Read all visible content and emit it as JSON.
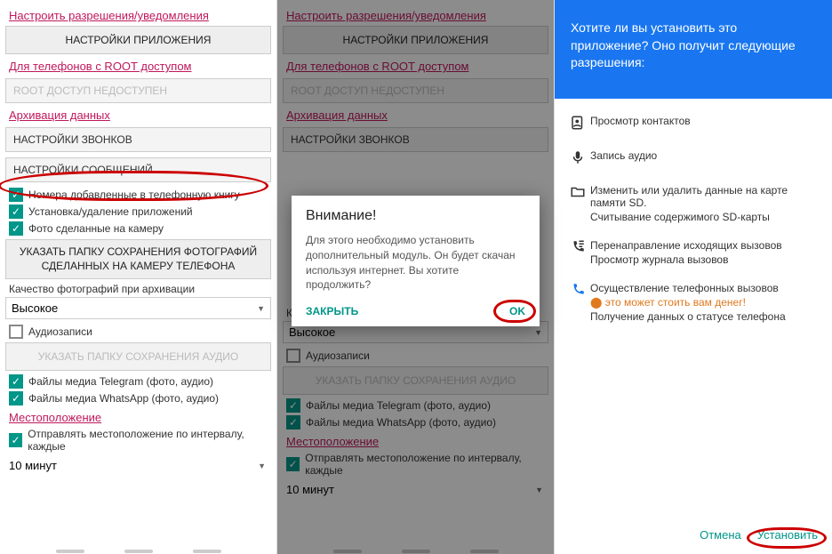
{
  "settings": {
    "permissions_title": "Настроить разрешения/уведомления",
    "app_settings_btn": "НАСТРОЙКИ ПРИЛОЖЕНИЯ",
    "root_title": "Для телефонов с ROOT доступом",
    "root_box": "ROOT ДОСТУП НЕДОСТУПЕН",
    "archive_title": "Архивация данных",
    "calls_box": "НАСТРОЙКИ ЗВОНКОВ",
    "messages_box": "НАСТРОЙКИ СООБЩЕНИЙ",
    "check_contacts": "Номера добавленные в телефонную книгу",
    "check_apps": "Установка/удаление приложений",
    "check_photos": "Фото сделанные на камеру",
    "photo_folder_btn": "УКАЗАТЬ ПАПКУ СОХРАНЕНИЯ ФОТОГРАФИЙ СДЕЛАННЫХ НА КАМЕРУ ТЕЛЕФОНА",
    "quality_label": "Качество фотографий при архивации",
    "quality_value": "Высокое",
    "check_audio": "Аудиозаписи",
    "audio_folder_btn": "УКАЗАТЬ ПАПКУ СОХРАНЕНИЯ АУДИО",
    "check_telegram": "Файлы медиа Telegram (фото, аудио)",
    "check_whatsapp": "Файлы медиа WhatsApp (фото, аудио)",
    "location_title": "Местоположение",
    "check_location": "Отправлять местоположение по интервалу, каждые",
    "interval_value": "10 минут"
  },
  "dialog": {
    "title": "Внимание!",
    "body": "Для этого необходимо установить дополнительный модуль. Он будет скачан используя интернет. Вы хотите продолжить?",
    "close": "ЗАКРЫТЬ",
    "ok": "OK"
  },
  "install": {
    "prompt": "Хотите ли вы установить это приложение? Оно получит следующие разрешения:",
    "perms": {
      "contacts": "Просмотр контактов",
      "audio": "Запись аудио",
      "sd1": "Изменить или удалить данные на карте памяти SD.",
      "sd2": "Считывание содержимого SD-карты",
      "calls1": "Перенаправление исходящих вызовов",
      "calls2": "Просмотр журнала вызовов",
      "phone1": "Осуществление телефонных вызовов",
      "phone_warn": "это может стоить вам денег!",
      "phone2": "Получение данных о статусе телефона"
    },
    "cancel": "Отмена",
    "install_btn": "Установить"
  }
}
